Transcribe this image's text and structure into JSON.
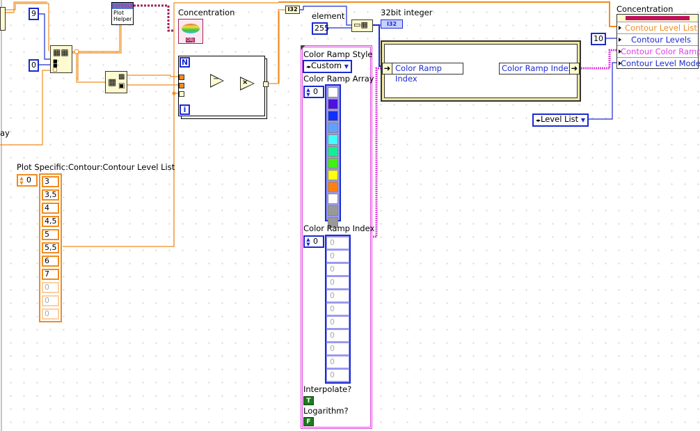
{
  "colors": {
    "orange_wire": "#f08c1e",
    "blue_wire": "#1a2ad0",
    "pink_wire": "#e040e0",
    "refnum": "#a0205a",
    "cluster_frame": "#f0e8a0"
  },
  "left": {
    "partial_label": "ay",
    "const_9": "9",
    "const_0": "0"
  },
  "plot_helper": {
    "top": "contour",
    "bottom": "Plot Helper"
  },
  "concentration_label": "Concentration",
  "concentration_icon_text": "OBJ",
  "for_loop": {
    "n": "N",
    "i": "i",
    "subtract": "−",
    "multiply": "×"
  },
  "i32_conversion": "I32",
  "element": {
    "label": "element",
    "value": "255"
  },
  "int32_indicator": {
    "label": "32bit integer",
    "type": "I32"
  },
  "unbundle_label": "Color Ramp Index",
  "bundle_label": "Color Ramp Index",
  "property_node": {
    "title": "Concentration",
    "rows": [
      {
        "label": "Contour Level List",
        "color": "#f08c1e"
      },
      {
        "label": "Contour Levels",
        "color": "#1a2ad0"
      },
      {
        "label": "Contour Color Ramp",
        "color": "#e040e0"
      },
      {
        "label": "Contour Level Mode",
        "color": "#1a2ad0"
      }
    ]
  },
  "contour_levels_const": "10",
  "level_mode_enum": "Level List",
  "level_list": {
    "label": "Plot Specific:Contour:Contour Level List",
    "index": "0",
    "values": [
      "3",
      "3,5",
      "4",
      "4,5",
      "5",
      "5,5",
      "6",
      "7"
    ],
    "empty": [
      "0",
      "0",
      "0"
    ]
  },
  "color_ramp_cluster": {
    "style_label": "Color Ramp Style",
    "style_value": "Custom",
    "array_label": "Color Ramp Array",
    "array_index": "0",
    "array_colors": [
      "#ffffff",
      "#5010e0",
      "#1030ff",
      "#60a0ff",
      "#40ffff",
      "#10f090",
      "#40f010",
      "#ffff10",
      "#ff8010",
      "#ffffff",
      "#999999",
      "#999999"
    ],
    "index_label": "Color Ramp Index",
    "index_index": "0",
    "index_values": [
      "0",
      "0",
      "0",
      "0",
      "0",
      "0",
      "0",
      "0",
      "0",
      "0",
      "0"
    ],
    "interpolate_label": "Interpolate?",
    "interpolate_value": "T",
    "log_label": "Logarithm?",
    "log_value": "F"
  }
}
